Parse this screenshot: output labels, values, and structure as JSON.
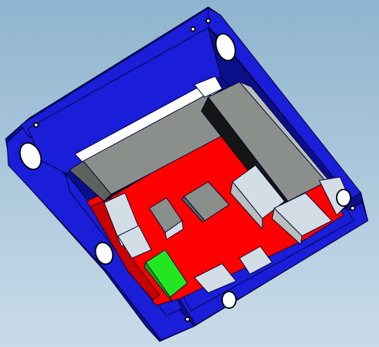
{
  "scene": {
    "subject": "3d-enclosure-pcb-render",
    "colors": {
      "background_top": "#8fb4cf",
      "background_bottom": "#c9dbe8",
      "enclosure_blue": "#1a1ed8",
      "enclosure_blue_dark": "#0c0f8a",
      "enclosure_edge": "#000030",
      "pcb_red": "#ff0000",
      "pcb_red_dark": "#c80000",
      "component_gray": "#8a8f8c",
      "component_gray_light": "#b9bfbc",
      "component_gray_dark": "#5d625f",
      "component_black": "#151515",
      "component_white": "#ffffff",
      "component_pale": "#d2dde5",
      "led_green": "#22e622"
    }
  }
}
